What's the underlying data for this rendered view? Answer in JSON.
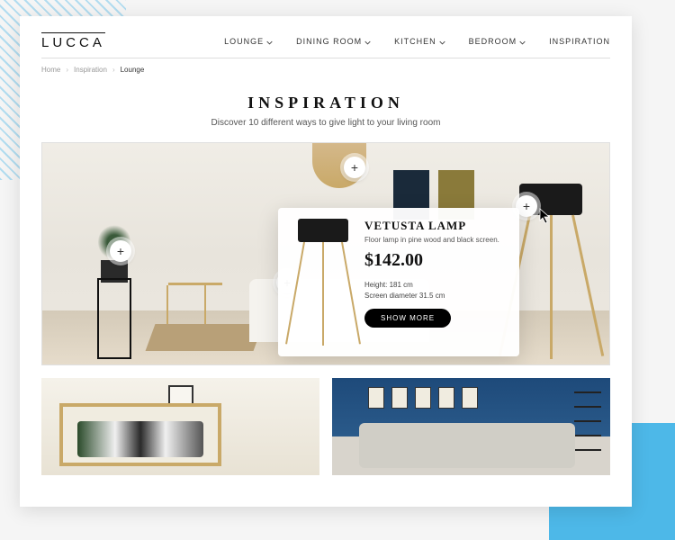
{
  "brand": "LUCCA",
  "nav": {
    "lounge": "LOUNGE",
    "dining": "DINING ROOM",
    "kitchen": "KITCHEN",
    "bedroom": "BEDROOM",
    "inspiration": "INSPIRATION"
  },
  "breadcrumb": {
    "home": "Home",
    "inspiration": "Inspiration",
    "current": "Lounge"
  },
  "hero": {
    "title": "INSPIRATION",
    "subtitle": "Discover 10 different ways to give light to your living room"
  },
  "product": {
    "name": "VETUSTA LAMP",
    "description": "Floor lamp in pine wood and black screen.",
    "price": "$142.00",
    "spec_height": "Height: 181 cm",
    "spec_diameter": "Screen diameter 31.5 cm",
    "cta": "SHOW MORE"
  }
}
